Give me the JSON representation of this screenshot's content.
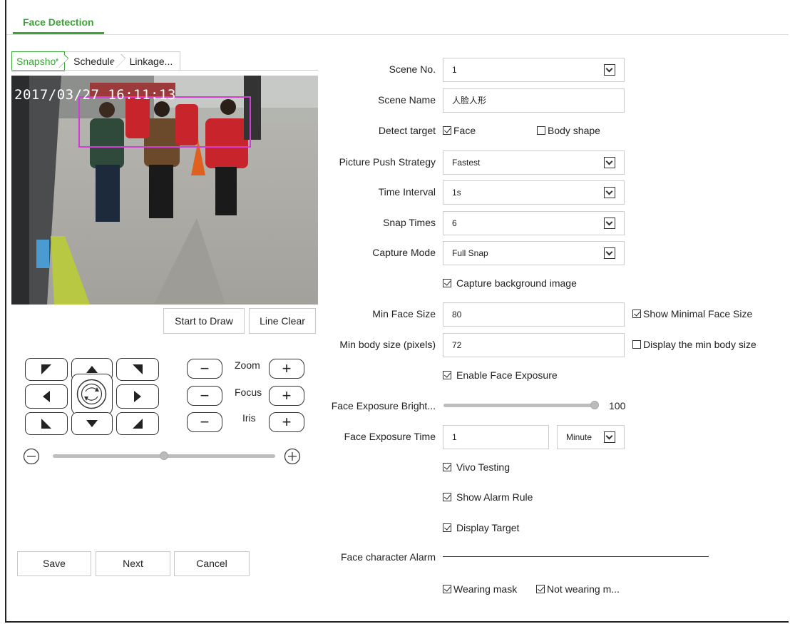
{
  "header": {
    "title": "Face Detection"
  },
  "subtabs": [
    {
      "label": "Snapshot",
      "active": true
    },
    {
      "label": "Schedule",
      "active": false
    },
    {
      "label": "Linkage...",
      "active": false
    }
  ],
  "video": {
    "timestamp": "2017/03/27 16:11:13"
  },
  "draw_buttons": {
    "start": "Start to Draw",
    "clear": "Line Clear"
  },
  "ptz": {
    "zoom": "Zoom",
    "focus": "Focus",
    "iris": "Iris",
    "minus": "−",
    "plus": "+",
    "speed_level": 0.5
  },
  "bottom_buttons": {
    "save": "Save",
    "next": "Next",
    "cancel": "Cancel"
  },
  "form": {
    "scene_no": {
      "label": "Scene No.",
      "value": "1"
    },
    "scene_name": {
      "label": "Scene Name",
      "value": "人脸人形"
    },
    "detect_target": {
      "label": "Detect target",
      "face": "Face",
      "face_checked": true,
      "body": "Body shape",
      "body_checked": false
    },
    "push_strategy": {
      "label": "Picture Push Strategy",
      "value": "Fastest"
    },
    "time_interval": {
      "label": "Time Interval",
      "value": "1s"
    },
    "snap_times": {
      "label": "Snap Times",
      "value": "6"
    },
    "capture_mode": {
      "label": "Capture Mode",
      "value": "Full Snap"
    },
    "capture_bg": {
      "label": "Capture background image",
      "checked": true
    },
    "min_face": {
      "label": "Min Face Size",
      "value": "80",
      "show_label": "Show Minimal Face Size",
      "show_checked": true
    },
    "min_body": {
      "label": "Min body size (pixels)",
      "value": "72",
      "show_label": "Display the min body size",
      "show_checked": false
    },
    "enable_exposure": {
      "label": "Enable Face Exposure",
      "checked": true
    },
    "exposure_brightness": {
      "label": "Face Exposure Bright...",
      "value": "100",
      "level": 1.0
    },
    "exposure_time": {
      "label": "Face Exposure Time",
      "value": "1",
      "unit": "Minute"
    },
    "vivo": {
      "label": "Vivo Testing",
      "checked": true
    },
    "alarm_rule": {
      "label": "Show Alarm Rule",
      "checked": true
    },
    "display_target": {
      "label": "Display Target",
      "checked": true
    },
    "char_alarm": {
      "label": "Face character Alarm"
    },
    "wearing_mask": {
      "label": "Wearing mask",
      "checked": true
    },
    "not_wearing_mask": {
      "label": "Not wearing m...",
      "checked": true
    }
  },
  "colors": {
    "accent": "#3aa535",
    "roi_box": "#d23cd8"
  }
}
